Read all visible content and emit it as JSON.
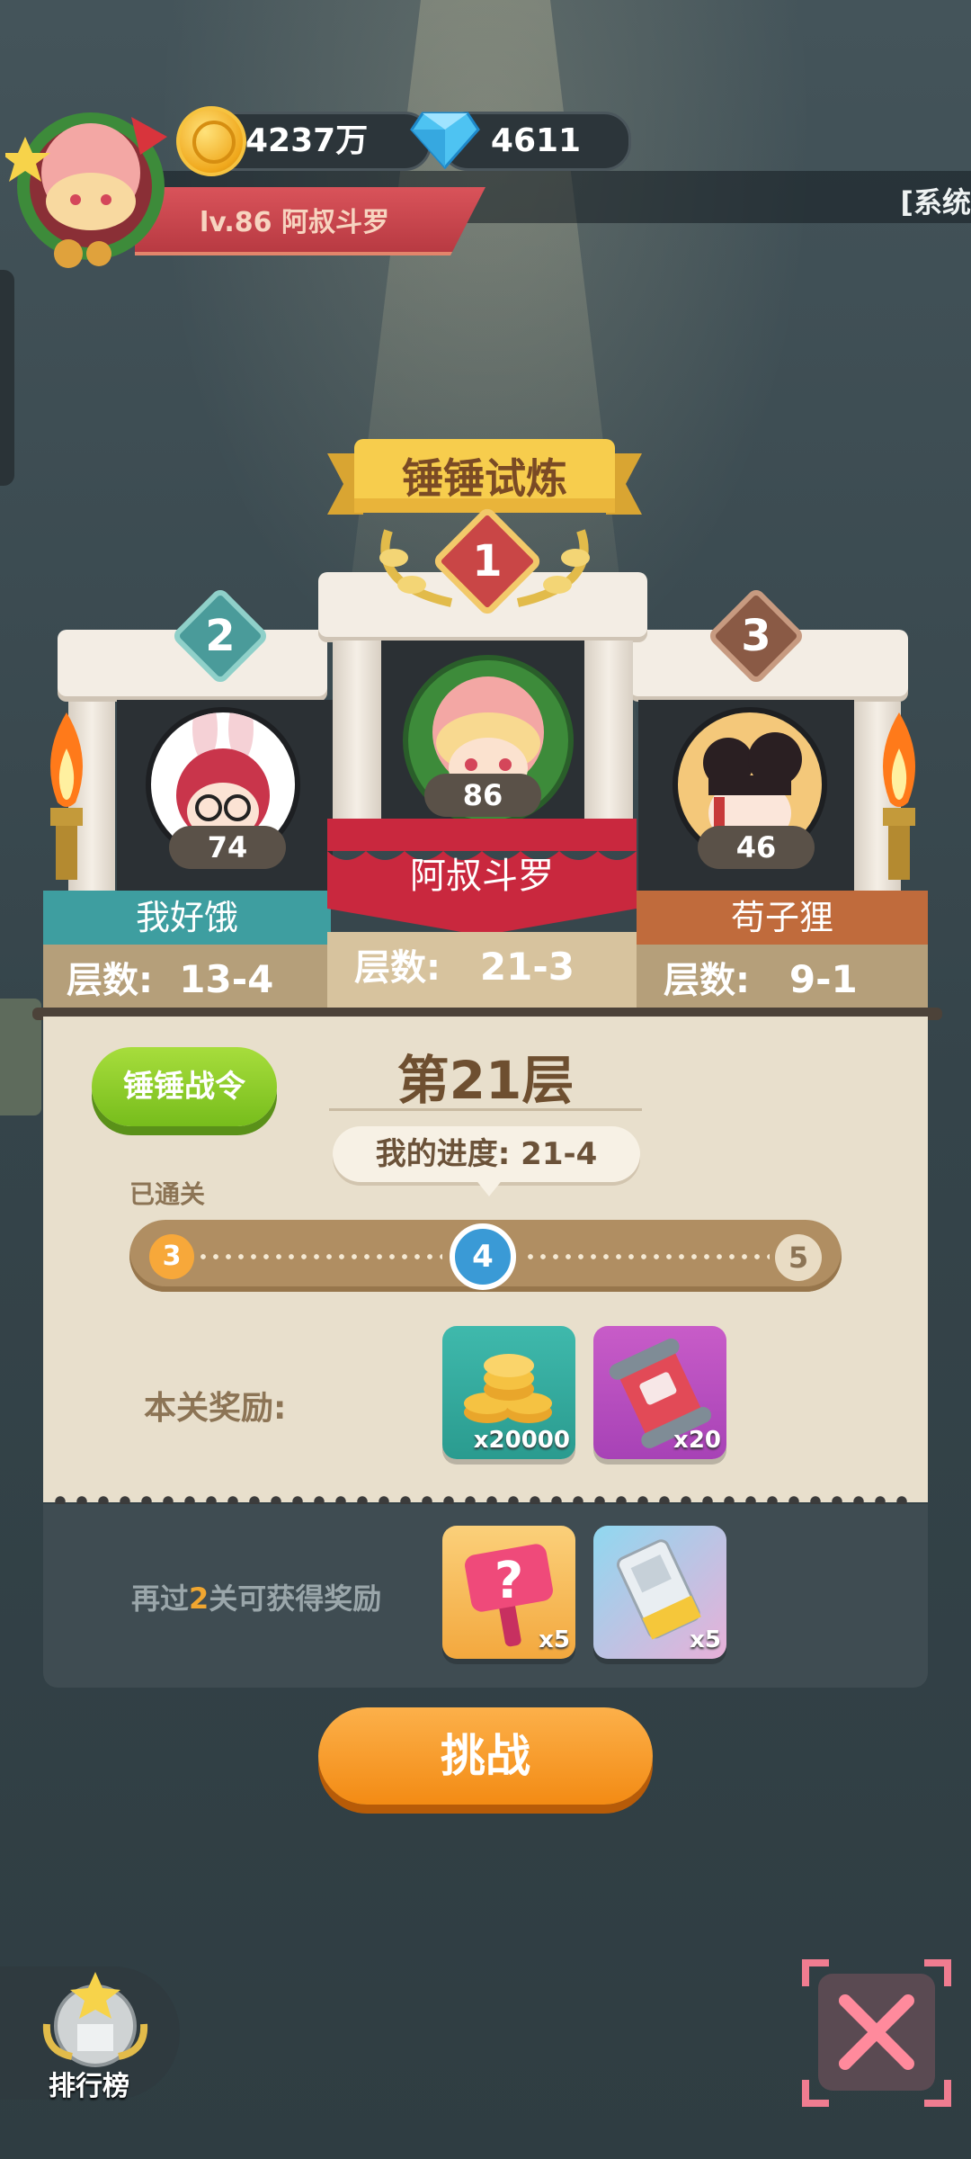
{
  "header": {
    "coins": "4237万",
    "diamonds": "4611",
    "player_level_name": "lv.86  阿叔斗罗",
    "ticker_text": "[系统"
  },
  "title": "锤锤试炼",
  "podium": {
    "first": {
      "rank": "1",
      "level": "86",
      "name": "阿叔斗罗",
      "floor_label": "层数:",
      "floor": "21-3"
    },
    "second": {
      "rank": "2",
      "level": "74",
      "name": "我好饿",
      "floor_label": "层数:",
      "floor": "13-4"
    },
    "third": {
      "rank": "3",
      "level": "46",
      "name": "苟子狸",
      "floor_label": "层数:",
      "floor": "9-1"
    }
  },
  "stage": {
    "battle_pass": "锤锤战令",
    "floor_title": "第21层",
    "my_progress": "我的进度: 21-4",
    "cleared_label": "已通关",
    "nodes": [
      "3",
      "4",
      "5"
    ],
    "reward_label": "本关奖励:",
    "rewards": [
      {
        "icon": "coins-stack-icon",
        "qty": "x20000"
      },
      {
        "icon": "scroll-ticket-icon",
        "qty": "x20"
      }
    ]
  },
  "bonus": {
    "text_before": "再过",
    "count": "2",
    "text_after": "关可获得奖励",
    "rewards": [
      {
        "icon": "mystery-hammer-icon",
        "qty": "x5"
      },
      {
        "icon": "card-pass-icon",
        "qty": "x5"
      }
    ]
  },
  "challenge_button": "挑战",
  "leaderboard_label": "排行榜"
}
